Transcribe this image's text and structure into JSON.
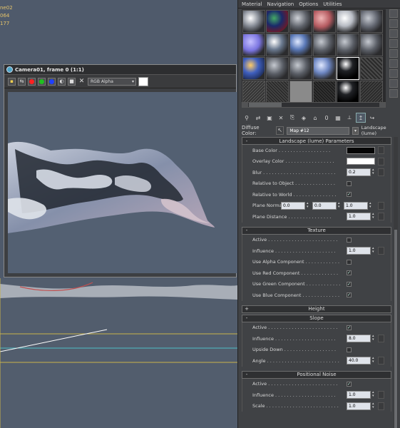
{
  "viewport": {
    "stats": [
      "ne02",
      "064",
      "177"
    ]
  },
  "camera_window": {
    "title": "Camera01, frame 0 (1:1)",
    "channel_select": "RGB Alpha",
    "colors": {
      "red": "#ff2020",
      "green": "#20c020",
      "blue": "#2040ff"
    }
  },
  "material_editor": {
    "menu": [
      "Material",
      "Navigation",
      "Options",
      "Utilities"
    ],
    "diffuse_label": "Diffuse Color:",
    "map_name": "Map #12",
    "map_type": "Landscape (lume)",
    "rollouts": {
      "params": {
        "sign": "-",
        "title": "Landscape (lume) Parameters",
        "base_color": "Base Color . . . . . . . . . . . . . . . . . .",
        "overlay_color": "Overlay Color . . . . . . . . . . . . . . . . .",
        "blur": "Blur . . . . . . . . . . . . . . . . . . . . . . . . .",
        "blur_value": "0.2",
        "relative_object": "Relative to Object . . . . . . . . . . . . . .",
        "relative_world": "Relative to World . . . . . . . . . . . . . . .",
        "plane_normal": "Plane Normal",
        "pn_x": "0.0",
        "pn_y": "0.0",
        "pn_z": "1.0",
        "plane_distance": "Plane Distance . . . . . . . . . . . . . . .",
        "plane_distance_value": "1.0"
      },
      "texture": {
        "sign": "-",
        "title": "Texture",
        "active": "Active . . . . . . . . . . . . . . . . . . . . . . . .",
        "influence": "Influence . . . . . . . . . . . . . . . . . . . . .",
        "influence_value": "1.0",
        "use_alpha": "Use Alpha Component . . . . . . . . . . . .",
        "use_red": "Use Red Component . . . . . . . . . . . . .",
        "use_green": "Use Green Component . . . . . . . . . . . .",
        "use_blue": "Use Blue Component . . . . . . . . . . . . ."
      },
      "height": {
        "sign": "+",
        "title": "Height"
      },
      "slope": {
        "sign": "-",
        "title": "Slope",
        "active": "Active . . . . . . . . . . . . . . . . . . . . . . . .",
        "influence": "Influence . . . . . . . . . . . . . . . . . . . . .",
        "influence_value": "8.0",
        "upside_down": "Upside Down . . . . . . . . . . . . . . . . . .",
        "angle": "Angle . . . . . . . . . . . . . . . . . . . . . . . . .",
        "angle_value": "40.0"
      },
      "positional_noise": {
        "sign": "-",
        "title": "Positional Noise",
        "active": "Active . . . . . . . . . . . . . . . . . . . . . . . .",
        "influence": "Influence . . . . . . . . . . . . . . . . . . . . .",
        "influence_value": "1.0",
        "scale": "Scale . . . . . . . . . . . . . . . . . . . . . . . . .",
        "scale_value": "1.0"
      }
    }
  }
}
